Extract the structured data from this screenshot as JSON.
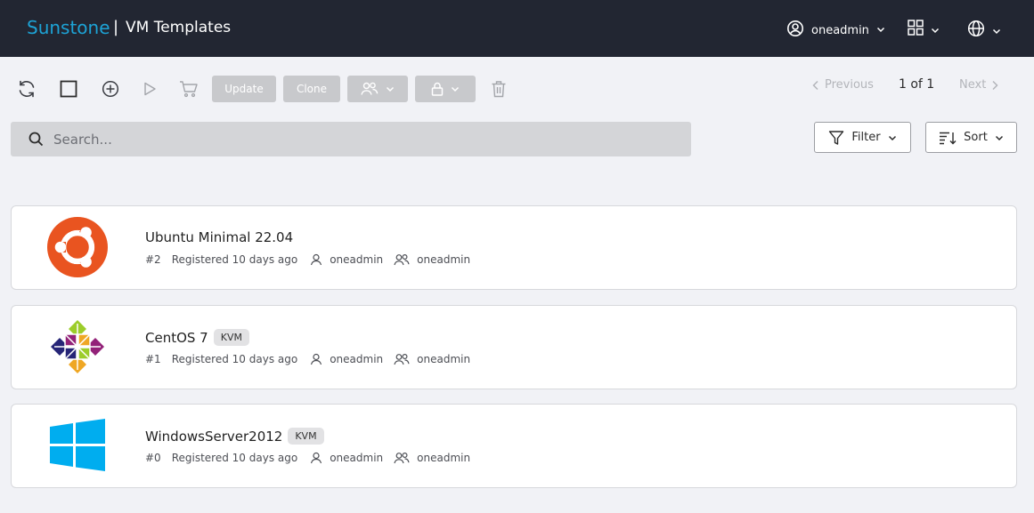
{
  "header": {
    "brand": "Sunstone",
    "separator": "|",
    "title": "VM Templates",
    "user": "oneadmin"
  },
  "toolbar": {
    "update_label": "Update",
    "clone_label": "Clone"
  },
  "pagination": {
    "previous": "Previous",
    "info": "1 of 1",
    "next": "Next"
  },
  "search": {
    "placeholder": "Search..."
  },
  "filter_label": "Filter",
  "sort_label": "Sort",
  "templates": [
    {
      "name": "Ubuntu Minimal 22.04",
      "badge": "",
      "id": "#2",
      "registered": "Registered 10 days ago",
      "owner": "oneadmin",
      "group": "oneadmin",
      "logo": "ubuntu-logo"
    },
    {
      "name": "CentOS 7",
      "badge": "KVM",
      "id": "#1",
      "registered": "Registered 10 days ago",
      "owner": "oneadmin",
      "group": "oneadmin",
      "logo": "centos-logo"
    },
    {
      "name": "WindowsServer2012",
      "badge": "KVM",
      "id": "#0",
      "registered": "Registered 10 days ago",
      "owner": "oneadmin",
      "group": "oneadmin",
      "logo": "windows-logo"
    }
  ],
  "colors": {
    "header_bg": "#222632",
    "brand": "#1da3d6",
    "ubuntu": "#e95420",
    "windows": "#00adef"
  }
}
